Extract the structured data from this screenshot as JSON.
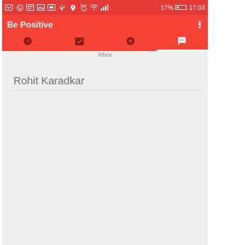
{
  "status_bar": {
    "battery": "17%",
    "time": "17:03"
  },
  "app_bar": {
    "title": "Be Positive"
  },
  "tabs": [
    {
      "icon": "clock-icon"
    },
    {
      "icon": "checkbox-icon"
    },
    {
      "icon": "add-circle-icon"
    },
    {
      "icon": "chat-icon",
      "active": true
    }
  ],
  "main": {
    "section_label": "Inbox",
    "items": [
      "Rohit Karadkar"
    ]
  },
  "colors": {
    "status_bar": "#e53935",
    "primary": "#f44336",
    "dark_icon": "#8b1a12",
    "background": "#eeeeee"
  }
}
